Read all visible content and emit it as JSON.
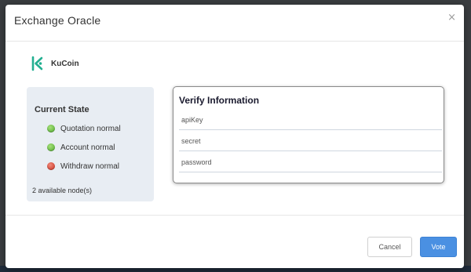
{
  "modal": {
    "title": "Exchange Oracle",
    "close_glyph": "×"
  },
  "exchange": {
    "name": "KuCoin",
    "logo_icon": "kucoin-logo-icon",
    "brand_color": "#23af91"
  },
  "current_state": {
    "title": "Current State",
    "items": [
      {
        "label": "Quotation normal",
        "status": "green",
        "icon": "status-dot-icon"
      },
      {
        "label": "Account normal",
        "status": "green",
        "icon": "status-dot-icon"
      },
      {
        "label": "Withdraw normal",
        "status": "red",
        "icon": "status-dot-icon"
      }
    ],
    "nodes_text": "2 available node(s)"
  },
  "verify": {
    "title": "Verify Information",
    "fields": [
      {
        "placeholder": "apiKey",
        "value": ""
      },
      {
        "placeholder": "secret",
        "value": ""
      },
      {
        "placeholder": "password",
        "value": ""
      }
    ]
  },
  "footer": {
    "cancel_label": "Cancel",
    "vote_label": "Vote"
  },
  "colors": {
    "accent": "#4a90e2",
    "status_green": "#4aa72a",
    "status_red": "#c62a1c",
    "panel_bg": "#e8edf3"
  }
}
